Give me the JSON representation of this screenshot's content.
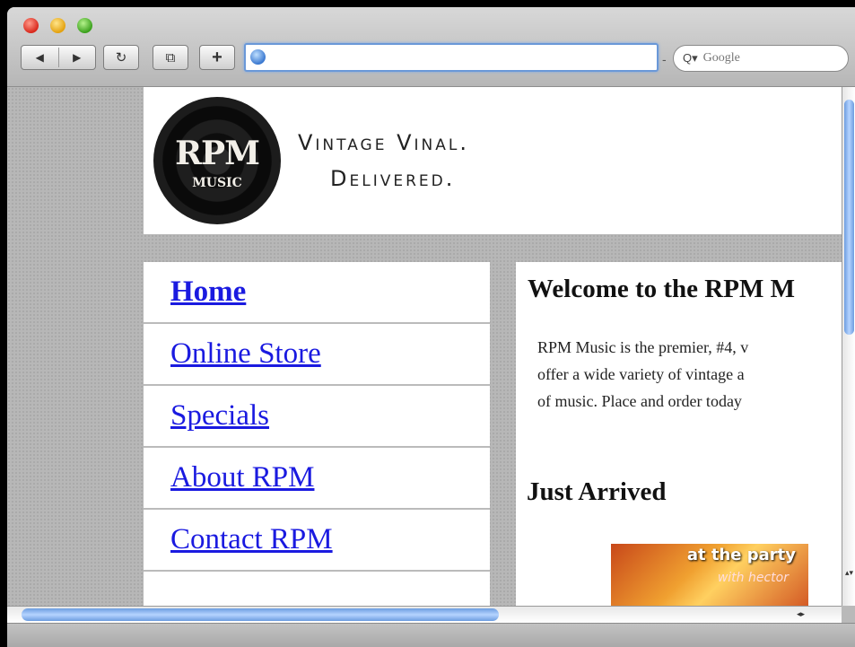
{
  "toolbar": {
    "back_glyph": "◀",
    "forward_glyph": "▶",
    "reload_glyph": "↻",
    "snapback_glyph": "⧉",
    "add_glyph": "+",
    "url_value": "",
    "search_placeholder": "Google",
    "search_glyph": "Q▾"
  },
  "site": {
    "logo_text": "RPM",
    "logo_subtext": "MUSIC",
    "tagline_line1": "Vintage Vinal.",
    "tagline_line2": "Delivered."
  },
  "nav": {
    "items": [
      {
        "label": "Home"
      },
      {
        "label": "Online Store"
      },
      {
        "label": "Specials"
      },
      {
        "label": "About RPM"
      },
      {
        "label": "Contact RPM"
      }
    ]
  },
  "main": {
    "welcome_title": "Welcome to the RPM M",
    "intro_lines": [
      "RPM Music is the premier, #4, v",
      "offer a wide variety of vintage a",
      "of music. Place and order today"
    ],
    "just_arrived_title": "Just Arrived",
    "album_title": "at the party",
    "album_subtitle": "with hector"
  },
  "scrollbars": {
    "vertical_arrows": "▴▾",
    "horizontal_arrows": "◂▸"
  },
  "colors": {
    "link": "#1a1ae0",
    "scroll_thumb": "#6d9de0"
  }
}
